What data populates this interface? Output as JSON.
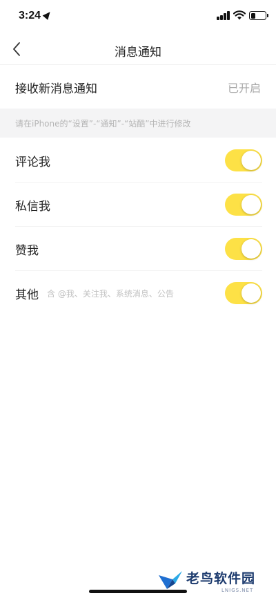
{
  "status_bar": {
    "time": "3:24",
    "location_icon": "location-arrow-icon",
    "signal_icon": "cellular-signal-icon",
    "wifi_icon": "wifi-icon",
    "battery_icon": "battery-icon",
    "battery_level": 0.3
  },
  "nav": {
    "back_icon": "chevron-left-icon",
    "title": "消息通知"
  },
  "receive": {
    "label": "接收新消息通知",
    "status": "已开启"
  },
  "hint": "请在iPhone的“设置”-“通知”-“站酷”中进行修改",
  "toggles": [
    {
      "label": "评论我",
      "note": "",
      "on": true
    },
    {
      "label": "私信我",
      "note": "",
      "on": true
    },
    {
      "label": "赞我",
      "note": "",
      "on": true
    },
    {
      "label": "其他",
      "note": "含 @我、关注我、系统消息、公告",
      "on": true
    }
  ],
  "watermark": {
    "logo_icon": "bird-logo-icon",
    "text": "老鸟软件园",
    "sub": "LNIGS.NET"
  },
  "colors": {
    "toggle_on": "#fde146",
    "background": "#ffffff",
    "hint_band": "#f4f4f5"
  }
}
